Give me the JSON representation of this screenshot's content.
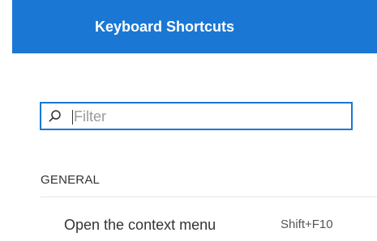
{
  "header": {
    "title": "Keyboard Shortcuts"
  },
  "filter": {
    "placeholder": "Filter",
    "value": "",
    "icon": "search-icon"
  },
  "sections": [
    {
      "title": "GENERAL",
      "items": [
        {
          "label": "Open the context menu",
          "keys": "Shift+F10"
        }
      ]
    }
  ],
  "colors": {
    "accent": "#1a78d4",
    "header_text": "#ffffff",
    "body_text": "#333333",
    "placeholder_text": "#9a9a9a",
    "divider": "#e6e6e6"
  }
}
